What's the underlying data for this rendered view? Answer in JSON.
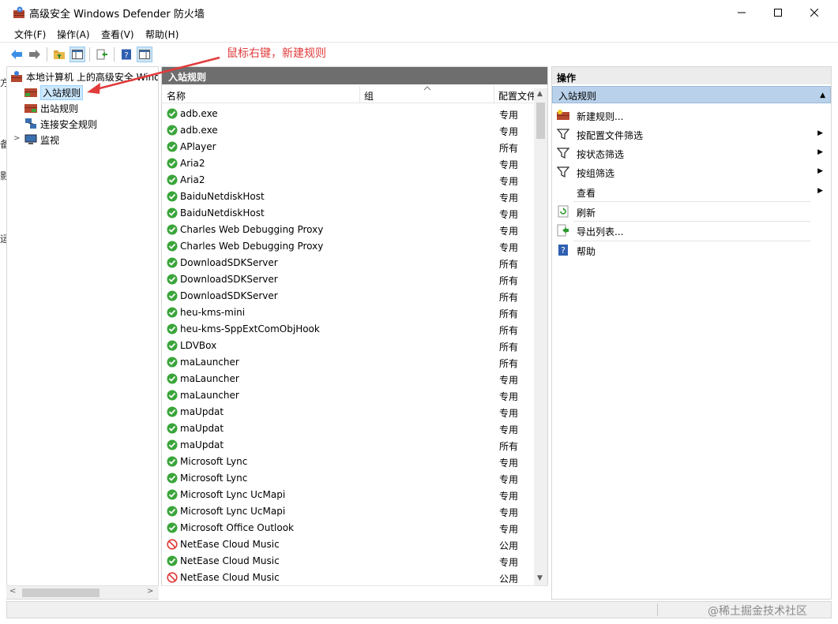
{
  "window": {
    "title": "高级安全 Windows Defender 防火墙"
  },
  "menu": [
    "文件(F)",
    "操作(A)",
    "查看(V)",
    "帮助(H)"
  ],
  "annotation": {
    "text": "鼠标右键，新建规则",
    "color": "#e23b3b"
  },
  "tree": {
    "root": "本地计算机 上的高级安全 Windows",
    "items": [
      "入站规则",
      "出站规则",
      "连接安全规则",
      "监视"
    ]
  },
  "list": {
    "header": "入站规则",
    "columns": {
      "name": "名称",
      "group": "组",
      "profile": "配置文件"
    },
    "rows": [
      {
        "name": "adb.exe",
        "profile": "专用",
        "status": "allow"
      },
      {
        "name": "adb.exe",
        "profile": "专用",
        "status": "allow"
      },
      {
        "name": "APlayer",
        "profile": "所有",
        "status": "allow"
      },
      {
        "name": "Aria2",
        "profile": "专用",
        "status": "allow"
      },
      {
        "name": "Aria2",
        "profile": "专用",
        "status": "allow"
      },
      {
        "name": "BaiduNetdiskHost",
        "profile": "专用",
        "status": "allow"
      },
      {
        "name": "BaiduNetdiskHost",
        "profile": "专用",
        "status": "allow"
      },
      {
        "name": "Charles Web Debugging Proxy",
        "profile": "专用",
        "status": "allow"
      },
      {
        "name": "Charles Web Debugging Proxy",
        "profile": "专用",
        "status": "allow"
      },
      {
        "name": "DownloadSDKServer",
        "profile": "所有",
        "status": "allow"
      },
      {
        "name": "DownloadSDKServer",
        "profile": "所有",
        "status": "allow"
      },
      {
        "name": "DownloadSDKServer",
        "profile": "所有",
        "status": "allow"
      },
      {
        "name": "heu-kms-mini",
        "profile": "所有",
        "status": "allow"
      },
      {
        "name": "heu-kms-SppExtComObjHook",
        "profile": "所有",
        "status": "allow"
      },
      {
        "name": "LDVBox",
        "profile": "所有",
        "status": "allow"
      },
      {
        "name": "maLauncher",
        "profile": "所有",
        "status": "allow"
      },
      {
        "name": "maLauncher",
        "profile": "专用",
        "status": "allow"
      },
      {
        "name": "maLauncher",
        "profile": "专用",
        "status": "allow"
      },
      {
        "name": "maUpdat",
        "profile": "专用",
        "status": "allow"
      },
      {
        "name": "maUpdat",
        "profile": "专用",
        "status": "allow"
      },
      {
        "name": "maUpdat",
        "profile": "所有",
        "status": "allow"
      },
      {
        "name": "Microsoft Lync",
        "profile": "专用",
        "status": "allow"
      },
      {
        "name": "Microsoft Lync",
        "profile": "专用",
        "status": "allow"
      },
      {
        "name": "Microsoft Lync UcMapi",
        "profile": "专用",
        "status": "allow"
      },
      {
        "name": "Microsoft Lync UcMapi",
        "profile": "专用",
        "status": "allow"
      },
      {
        "name": "Microsoft Office Outlook",
        "profile": "专用",
        "status": "allow"
      },
      {
        "name": "NetEase Cloud Music",
        "profile": "公用",
        "status": "block"
      },
      {
        "name": "NetEase Cloud Music",
        "profile": "专用",
        "status": "allow"
      },
      {
        "name": "NetEase Cloud Music",
        "profile": "公用",
        "status": "block"
      }
    ]
  },
  "actions": {
    "header": "操作",
    "section": "入站规则",
    "items": [
      {
        "label": "新建规则...",
        "icon": "new-rule-icon",
        "submenu": false
      },
      {
        "label": "按配置文件筛选",
        "icon": "filter-icon",
        "submenu": true
      },
      {
        "label": "按状态筛选",
        "icon": "filter-icon",
        "submenu": true
      },
      {
        "label": "按组筛选",
        "icon": "filter-icon",
        "submenu": true
      },
      {
        "label": "查看",
        "icon": "",
        "submenu": true
      },
      {
        "label": "刷新",
        "icon": "refresh-icon",
        "submenu": false
      },
      {
        "label": "导出列表...",
        "icon": "export-icon",
        "submenu": false
      },
      {
        "label": "帮助",
        "icon": "help-icon",
        "submenu": false
      }
    ]
  },
  "watermark": "@稀土掘金技术社区",
  "colors": {
    "allow": "#3aa53a",
    "block": "#e03a3a",
    "section": "#b9d1ea",
    "header": "#6e6e6e"
  }
}
